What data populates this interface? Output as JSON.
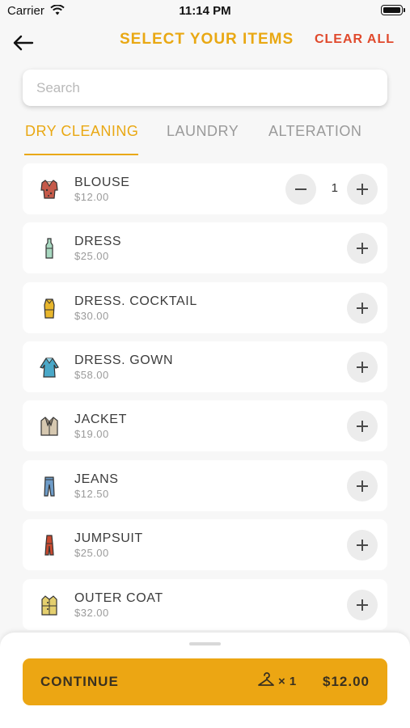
{
  "status_bar": {
    "carrier": "Carrier",
    "time": "11:14 PM"
  },
  "header": {
    "title": "SELECT YOUR ITEMS",
    "clear_all": "CLEAR ALL"
  },
  "search": {
    "placeholder": "Search",
    "value": ""
  },
  "tabs": [
    {
      "label": "DRY CLEANING",
      "active": true
    },
    {
      "label": "LAUNDRY",
      "active": false
    },
    {
      "label": "ALTERATION",
      "active": false
    }
  ],
  "items": [
    {
      "name": "BLOUSE",
      "price": "$12.00",
      "qty": "1",
      "icon": "blouse-icon"
    },
    {
      "name": "DRESS",
      "price": "$25.00",
      "icon": "dress-icon"
    },
    {
      "name": "DRESS. COCKTAIL",
      "price": "$30.00",
      "icon": "cocktail-dress-icon"
    },
    {
      "name": "DRESS. GOWN",
      "price": "$58.00",
      "icon": "gown-icon"
    },
    {
      "name": "JACKET",
      "price": "$19.00",
      "icon": "jacket-icon"
    },
    {
      "name": "JEANS",
      "price": "$12.50",
      "icon": "jeans-icon"
    },
    {
      "name": "JUMPSUIT",
      "price": "$25.00",
      "icon": "jumpsuit-icon"
    },
    {
      "name": "OUTER COAT",
      "price": "$32.00",
      "icon": "outer-coat-icon"
    }
  ],
  "footer": {
    "continue_label": "CONTINUE",
    "count": "× 1",
    "total": "$12.00"
  },
  "colors": {
    "accent": "#e9a813",
    "danger": "#e0492c",
    "button": "#eca613"
  }
}
